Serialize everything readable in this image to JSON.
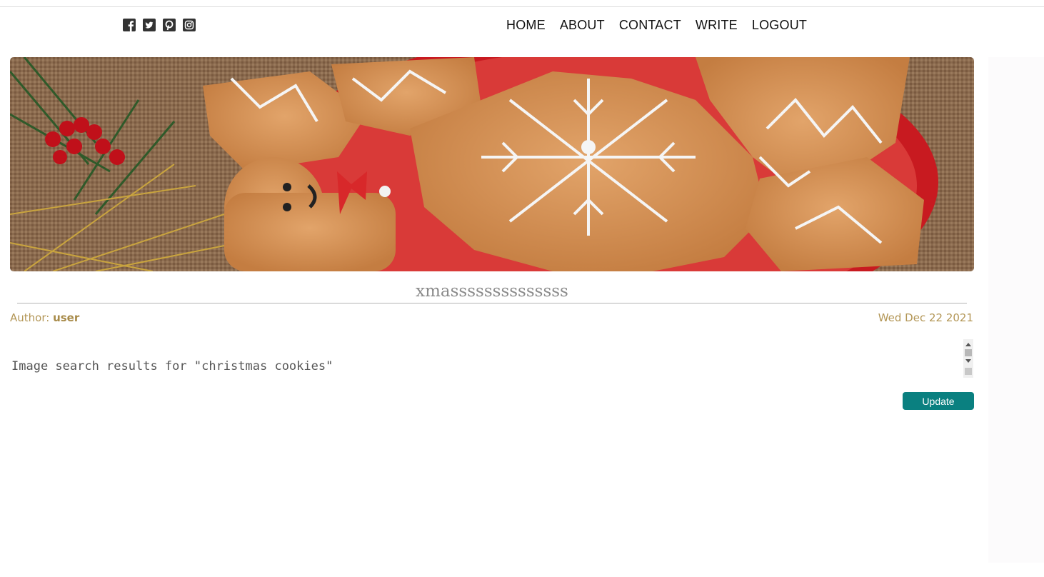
{
  "nav": {
    "social": [
      {
        "name": "facebook-icon"
      },
      {
        "name": "twitter-icon"
      },
      {
        "name": "pinterest-icon"
      },
      {
        "name": "instagram-icon"
      }
    ],
    "links": [
      "HOME",
      "ABOUT",
      "CONTACT",
      "WRITE",
      "LOGOUT"
    ]
  },
  "post": {
    "title": "xmassssssssssssss",
    "author_label": "Author:",
    "author": "user",
    "date": "Wed Dec 22 2021",
    "body": "Image search results for \"christmas cookies\"",
    "update_label": "Update"
  },
  "colors": {
    "accent": "#0a8080",
    "meta": "#b39656"
  }
}
